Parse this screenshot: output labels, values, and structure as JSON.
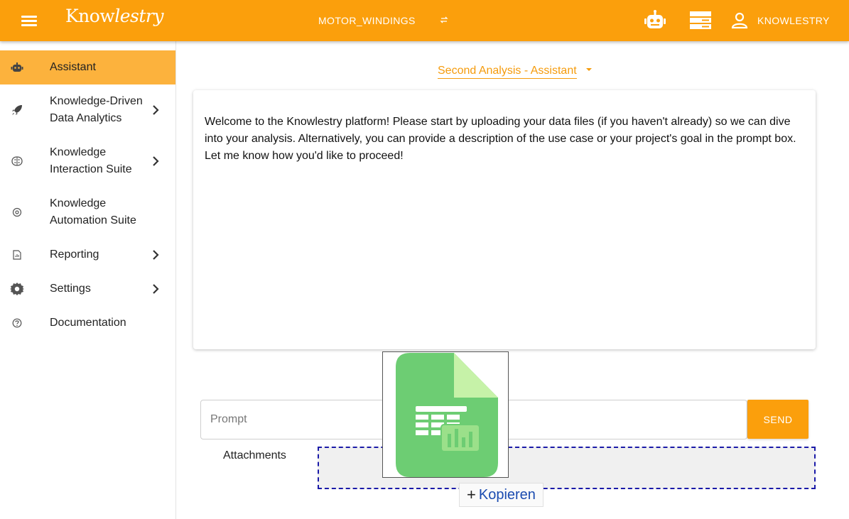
{
  "header": {
    "logo": "Know",
    "logo_script": "lestry",
    "project": "MOTOR_WINDINGS",
    "user": "KNOWLESTRY"
  },
  "sidebar": {
    "items": [
      {
        "label": "Assistant",
        "icon": "robot-icon",
        "active": true
      },
      {
        "label": "Knowledge-Driven Data Analytics",
        "line1": "Knowledge-Driven",
        "line2": "Data Analytics",
        "icon": "rocket-icon",
        "chevron": true
      },
      {
        "label": "Knowledge Interaction Suite",
        "line1": "Knowledge",
        "line2": "Interaction Suite",
        "icon": "brain-icon",
        "chevron": true
      },
      {
        "label": "Knowledge Automation Suite",
        "line1": "Knowledge",
        "line2": "Automation Suite",
        "icon": "automation-icon"
      },
      {
        "label": "Reporting",
        "icon": "report-icon",
        "chevron": true
      },
      {
        "label": "Settings",
        "icon": "gear-icon",
        "chevron": true
      },
      {
        "label": "Documentation",
        "icon": "help-icon"
      }
    ]
  },
  "main": {
    "analysis_title": "Second Analysis - Assistant",
    "welcome_message": "Welcome to the Knowlestry platform! Please start by uploading your data files (if you haven't already) so we can dive into your analysis. Alternatively, you can provide a description of the use case or your project's goal in the prompt box. Let me know how you'd like to proceed!",
    "prompt_placeholder": "Prompt",
    "send_label": "SEND",
    "attachments_label": "Attachments",
    "copy_label": "Kopieren"
  },
  "colors": {
    "accent": "#fb9f0c",
    "active_item": "#fcb23d",
    "dropzone_border": "#1a1aa8",
    "file_icon_green": "#6dcd73"
  }
}
